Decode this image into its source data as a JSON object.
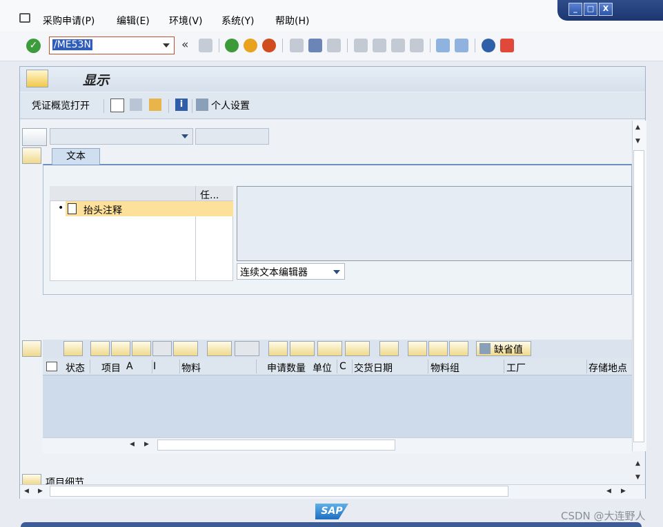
{
  "menu": {
    "items": [
      "采购申请(P)",
      "编辑(E)",
      "环境(V)",
      "系统(Y)",
      "帮助(H)"
    ]
  },
  "window_controls": {
    "minimize": "_",
    "maximize": "□",
    "close": "X"
  },
  "command_field": {
    "value": "/ME53N"
  },
  "toolbar": {
    "back_fast_label": "«"
  },
  "screen": {
    "title": "显示"
  },
  "app_toolbar": {
    "doc_overview_label": "凭证概览打开",
    "personal_settings_label": "个人设置"
  },
  "header": {
    "doc_type_value": "",
    "doc_number_value": ""
  },
  "text_section": {
    "tab_label": "文本",
    "tree_column_2": "任...",
    "tree_item": "抬头注释",
    "editor_select": "连续文本编辑器"
  },
  "item_toolbar": {
    "default_values_label": "缺省值"
  },
  "item_table": {
    "columns": [
      "状态",
      "项目",
      "A",
      "I",
      "物料",
      "申请数量",
      "单位",
      "C",
      "交货日期",
      "物料组",
      "工厂",
      "存储地点"
    ]
  },
  "item_detail": {
    "label": "项目细节"
  },
  "status": {
    "logo_text": "SAP"
  },
  "watermark": "CSDN @大连野人",
  "colors": {
    "window_blue": "#1d3670",
    "highlight": "#fde19a",
    "accent": "#2f5dbd"
  }
}
